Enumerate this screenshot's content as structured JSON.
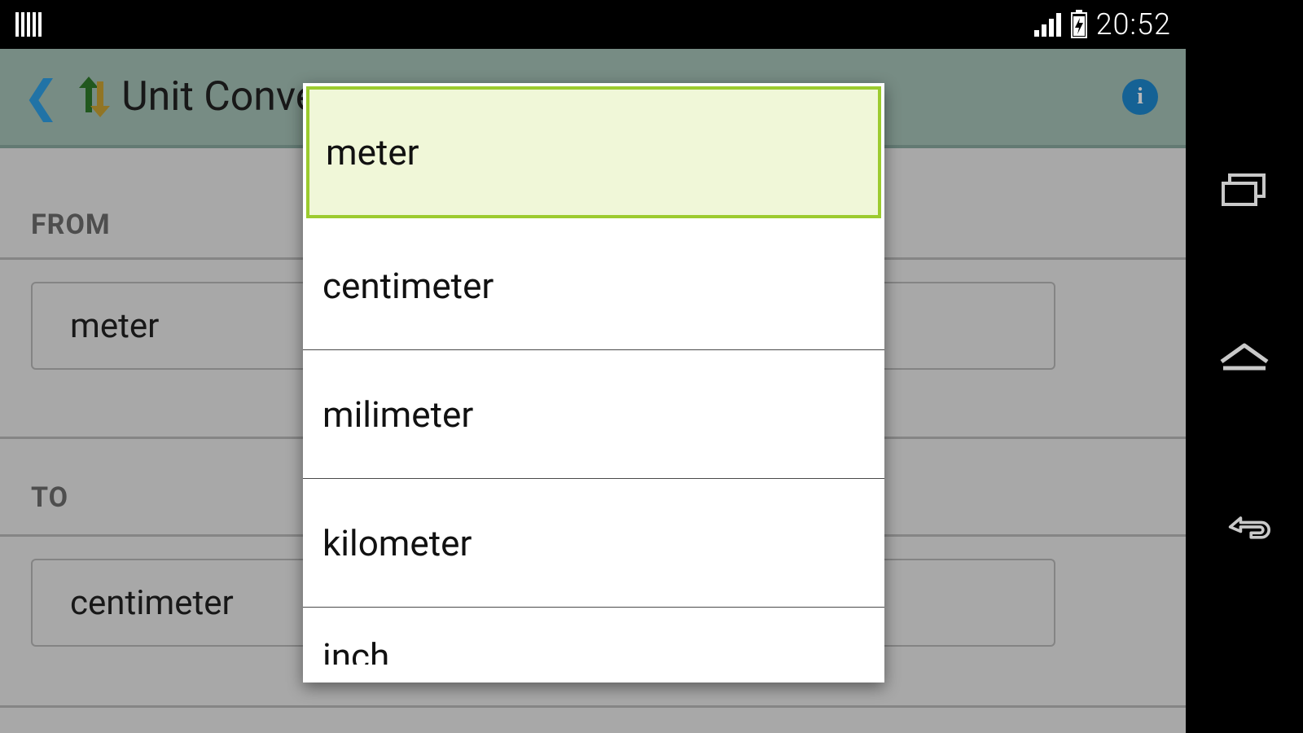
{
  "status": {
    "time": "20:52"
  },
  "titlebar": {
    "title": "Unit Converter"
  },
  "form": {
    "from_label": "FROM",
    "to_label": "TO",
    "from_value": "meter",
    "to_value": "centimeter"
  },
  "dialog": {
    "options": [
      "meter",
      "centimeter",
      "milimeter",
      "kilometer",
      "inch"
    ],
    "selected_index": 0
  }
}
